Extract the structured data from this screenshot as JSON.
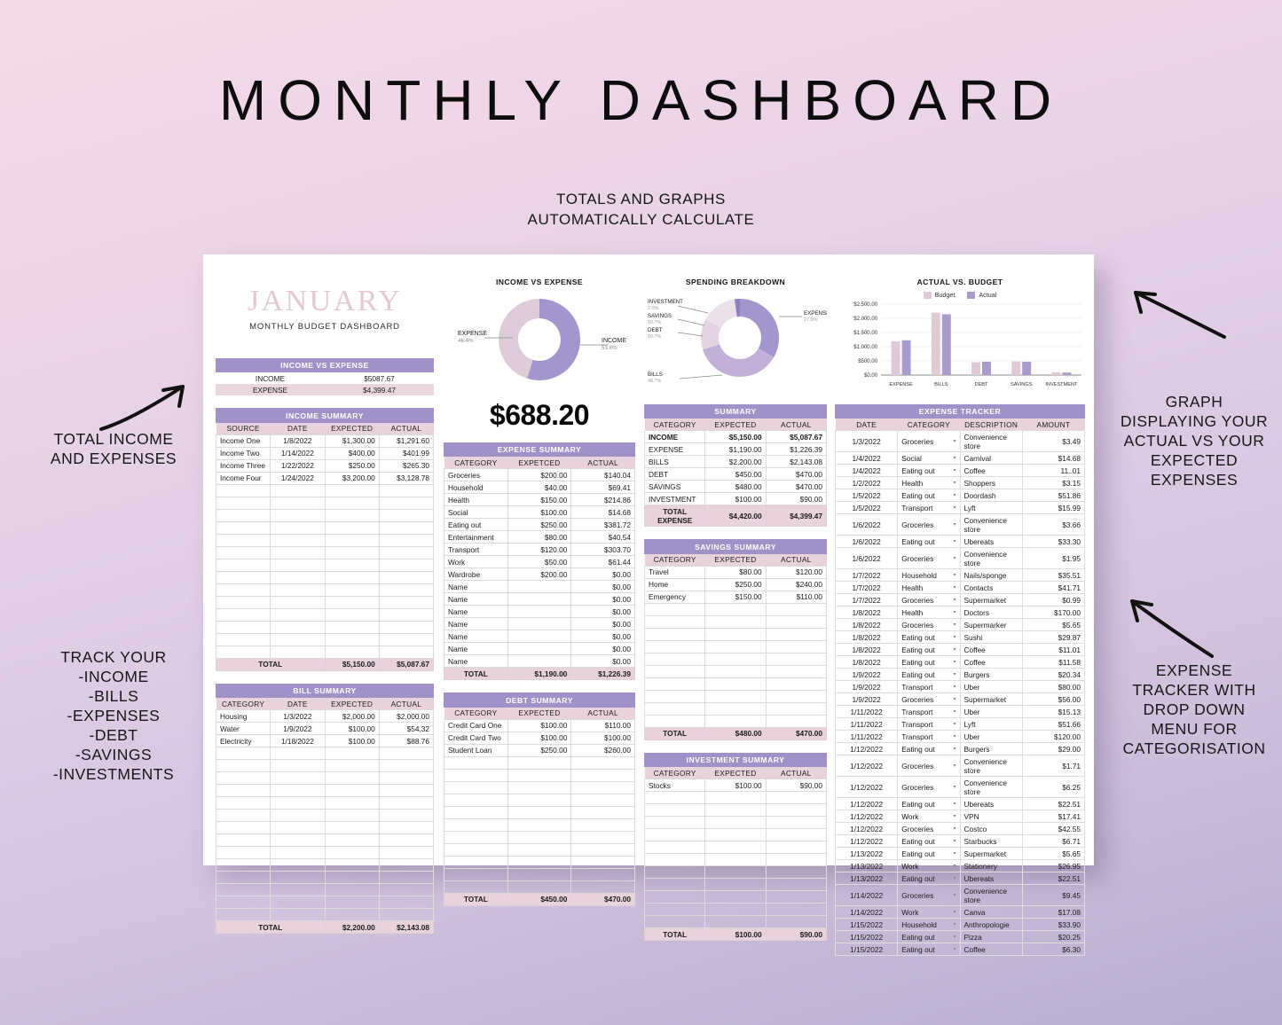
{
  "page": {
    "headline": "MONTHLY DASHBOARD",
    "subhead_line1": "TOTALS AND GRAPHS",
    "subhead_line2": "AUTOMATICALLY CALCULATE"
  },
  "annotations": {
    "top_left": "TOTAL INCOME\nAND EXPENSES",
    "bottom_left": "TRACK YOUR\n-INCOME\n-BILLS\n-EXPENSES\n-DEBT\n-SAVINGS\n-INVESTMENTS",
    "top_right": "GRAPH\nDISPLAYING YOUR\nACTUAL VS YOUR\nEXPECTED\nEXPENSES",
    "bottom_right": "EXPENSE\nTRACKER WITH\nDROP DOWN\nMENU FOR\nCATEGORISATION"
  },
  "colors": {
    "purple_header": "#a092c8",
    "pink_header": "#e8d3dd",
    "donut_income": "#a396cc",
    "donut_expense": "#decbd9",
    "bar_budget": "#e0c9d6",
    "bar_actual": "#a89ccd"
  },
  "sheet": {
    "month_title": "JANUARY",
    "month_subtitle": "MONTHLY BUDGET DASHBOARD",
    "income_vs_expense": {
      "title": "INCOME VS EXPENSE",
      "income_label": "INCOME",
      "income_value": "$5087.67",
      "expense_label": "EXPENSE",
      "expense_value": "$4,399.47"
    },
    "income_summary": {
      "title": "INCOME SUMMARY",
      "headers": [
        "SOURCE",
        "DATE",
        "EXPECTED",
        "ACTUAL"
      ],
      "rows": [
        [
          "Income One",
          "1/8/2022",
          "$1,300.00",
          "$1,291.60"
        ],
        [
          "Income Two",
          "1/14/2022",
          "$400.00",
          "$401.99"
        ],
        [
          "Income Three",
          "1/22/2022",
          "$250.00",
          "$265.30"
        ],
        [
          "Income Four",
          "1/24/2022",
          "$3,200.00",
          "$3,128.78"
        ]
      ],
      "blank_rows": 14,
      "total_label": "TOTAL",
      "total_expected": "$5,150.00",
      "total_actual": "$5,087.67"
    },
    "bill_summary": {
      "title": "BILL SUMMARY",
      "headers": [
        "CATEGORY",
        "DATE",
        "EXPECTED",
        "ACTUAL"
      ],
      "rows": [
        [
          "Housing",
          "1/3/2022",
          "$2,000.00",
          "$2,000.00"
        ],
        [
          "Water",
          "1/9/2022",
          "$100.00",
          "$54.32"
        ],
        [
          "Electricity",
          "1/18/2022",
          "$100.00",
          "$88.76"
        ]
      ],
      "blank_rows": 14,
      "total_label": "TOTAL",
      "total_expected": "$2,200.00",
      "total_actual": "$2,143.08"
    },
    "expense_summary": {
      "title": "EXPENSE SUMMARY",
      "headers": [
        "CATEGORY",
        "EXPETCED",
        "ACTUAL"
      ],
      "rows": [
        [
          "Groceries",
          "$200.00",
          "$140.04"
        ],
        [
          "Household",
          "$40.00",
          "$69.41"
        ],
        [
          "Health",
          "$150.00",
          "$214.86"
        ],
        [
          "Social",
          "$100.00",
          "$14.68"
        ],
        [
          "Eating out",
          "$250.00",
          "$381.72"
        ],
        [
          "Entertainment",
          "$80.00",
          "$40.54"
        ],
        [
          "Transport",
          "$120.00",
          "$303.70"
        ],
        [
          "Work",
          "$50.00",
          "$61.44"
        ],
        [
          "Wardrobe",
          "$200.00",
          "$0.00"
        ],
        [
          "Name",
          "",
          "$0.00"
        ],
        [
          "Name",
          "",
          "$0.00"
        ],
        [
          "Name",
          "",
          "$0.00"
        ],
        [
          "Name",
          "",
          "$0.00"
        ],
        [
          "Name",
          "",
          "$0.00"
        ],
        [
          "Name",
          "",
          "$0.00"
        ],
        [
          "Name",
          "",
          "$0.00"
        ]
      ],
      "total_label": "TOTAL",
      "total_expected": "$1,190.00",
      "total_actual": "$1,226.39"
    },
    "debt_summary": {
      "title": "DEBT SUMMARY",
      "headers": [
        "CATEGORY",
        "EXPECTED",
        "ACTUAL"
      ],
      "rows": [
        [
          "Credit Card One",
          "$100.00",
          "$110.00"
        ],
        [
          "Credit Card Two",
          "$100.00",
          "$100.00"
        ],
        [
          "Student Loan",
          "$250.00",
          "$260.00"
        ]
      ],
      "blank_rows": 11,
      "total_label": "TOTAL",
      "total_expected": "$450.00",
      "total_actual": "$470.00"
    },
    "summary": {
      "title": "SUMMARY",
      "headers": [
        "CATEGORY",
        "EXPECTED",
        "ACTUAL"
      ],
      "rows": [
        [
          "INCOME",
          "$5,150.00",
          "$5,087.67"
        ],
        [
          "EXPENSE",
          "$1,190.00",
          "$1,226.39"
        ],
        [
          "BILLS",
          "$2,200.00",
          "$2,143.08"
        ],
        [
          "DEBT",
          "$450.00",
          "$470.00"
        ],
        [
          "SAVINGS",
          "$480.00",
          "$470.00"
        ],
        [
          "INVESTMENT",
          "$100.00",
          "$90.00"
        ]
      ],
      "total_label": "TOTAL EXPENSE",
      "total_expected": "$4,420.00",
      "total_actual": "$4,399.47"
    },
    "savings_summary": {
      "title": "SAVINGS SUMMARY",
      "headers": [
        "CATEGORY",
        "EXPECTED",
        "ACTUAL"
      ],
      "rows": [
        [
          "Travel",
          "$80.00",
          "$120.00"
        ],
        [
          "Home",
          "$250.00",
          "$240.00"
        ],
        [
          "Emergency",
          "$150.00",
          "$110.00"
        ]
      ],
      "blank_rows": 10,
      "total_label": "TOTAL",
      "total_expected": "$480.00",
      "total_actual": "$470.00"
    },
    "investment_summary": {
      "title": "INVESTMENT SUMMARY",
      "headers": [
        "CATEGORY",
        "EXPECTED",
        "ACTUAL"
      ],
      "rows": [
        [
          "Stocks",
          "$100.00",
          "$90.00"
        ]
      ],
      "blank_rows": 11,
      "total_label": "TOTAL",
      "total_expected": "$100.00",
      "total_actual": "$90.00"
    },
    "expense_tracker": {
      "title": "EXPENSE TRACKER",
      "headers": [
        "DATE",
        "CATEGORY",
        "DESCRIPTION",
        "AMOUNT"
      ],
      "rows": [
        [
          "1/3/2022",
          "Groceries",
          "Convenience store",
          "$3.49"
        ],
        [
          "1/4/2022",
          "Social",
          "Carnival",
          "$14.68"
        ],
        [
          "1/4/2022",
          "Eating out",
          "Coffee",
          "11..01"
        ],
        [
          "1/2/2022",
          "Health",
          "Shoppers",
          "$3.15"
        ],
        [
          "1/5/2022",
          "Eating out",
          "Doordash",
          "$51.86"
        ],
        [
          "1/5/2022",
          "Transport",
          "Lyft",
          "$15.99"
        ],
        [
          "1/6/2022",
          "Groceries",
          "Convenience store",
          "$3.66"
        ],
        [
          "1/6/2022",
          "Eating out",
          "Ubereats",
          "$33.30"
        ],
        [
          "1/6/2022",
          "Groceries",
          "Convenience store",
          "$1.95"
        ],
        [
          "1/7/2022",
          "Household",
          "Nails/sponge",
          "$35.51"
        ],
        [
          "1/7/2022",
          "Health",
          "Contacts",
          "$41.71"
        ],
        [
          "1/7/2022",
          "Groceries",
          "Supermarket",
          "$0.99"
        ],
        [
          "1/8/2022",
          "Health",
          "Doctors",
          "$170.00"
        ],
        [
          "1/8/2022",
          "Groceries",
          "Supermarker",
          "$5.65"
        ],
        [
          "1/8/2022",
          "Eating out",
          "Sushi",
          "$29.87"
        ],
        [
          "1/8/2022",
          "Eating out",
          "Coffee",
          "$11.01"
        ],
        [
          "1/8/2022",
          "Eating out",
          "Coffee",
          "$11.58"
        ],
        [
          "1/9/2022",
          "Eating out",
          "Burgers",
          "$20.34"
        ],
        [
          "1/9/2022",
          "Transport",
          "Uber",
          "$80.00"
        ],
        [
          "1/9/2022",
          "Groceries",
          "Supermarket",
          "$56.00"
        ],
        [
          "1/11/2022",
          "Transport",
          "Uber",
          "$15.13"
        ],
        [
          "1/11/2022",
          "Transport",
          "Lyft",
          "$51.66"
        ],
        [
          "1/11/2022",
          "Transport",
          "Uber",
          "$120.00"
        ],
        [
          "1/12/2022",
          "Eating out",
          "Burgers",
          "$29.00"
        ],
        [
          "1/12/2022",
          "Groceries",
          "Convenience store",
          "$1.71"
        ],
        [
          "1/12/2022",
          "Groceries",
          "Convenience store",
          "$6.25"
        ],
        [
          "1/12/2022",
          "Eating out",
          "Ubereats",
          "$22.51"
        ],
        [
          "1/12/2022",
          "Work",
          "VPN",
          "$17.41"
        ],
        [
          "1/12/2022",
          "Groceries",
          "Costco",
          "$42.55"
        ],
        [
          "1/12/2022",
          "Eating out",
          "Starbucks",
          "$6.71"
        ],
        [
          "1/13/2022",
          "Eating out",
          "Supermarket",
          "$5.65"
        ],
        [
          "1/13/2022",
          "Work",
          "Stationery",
          "$26.95"
        ],
        [
          "1/13/2022",
          "Eating out",
          "Ubereats",
          "$22.51"
        ],
        [
          "1/14/2022",
          "Groceries",
          "Convenience store",
          "$9.45"
        ],
        [
          "1/14/2022",
          "Work",
          "Canva",
          "$17.08"
        ],
        [
          "1/15/2022",
          "Household",
          "Anthropologie",
          "$33.90"
        ],
        [
          "1/15/2022",
          "Eating out",
          "Pizza",
          "$20.25"
        ],
        [
          "1/15/2022",
          "Eating out",
          "Coffee",
          "$6.30"
        ]
      ]
    }
  },
  "chart_data": [
    {
      "type": "pie",
      "id": "income-vs-expense-donut",
      "title": "INCOME VS EXPENSE",
      "labels": [
        "INCOME",
        "EXPENSE"
      ],
      "values": [
        53.6,
        46.4
      ],
      "value_labels": [
        "53.6%",
        "46.4%"
      ],
      "colors": [
        "#a396cc",
        "#decbd9"
      ],
      "center_value": "$688.20",
      "legend": "callout-labels"
    },
    {
      "type": "pie",
      "id": "spending-breakdown-donut",
      "title": "SPENDING BREAKDOWN",
      "labels": [
        "EXPENSE",
        "BILLS",
        "DEBT",
        "SAVINGS",
        "INVESTMENT"
      ],
      "values": [
        27.9,
        48.7,
        10.7,
        10.7,
        2.0
      ],
      "value_labels": [
        "27.9%",
        "48.7%",
        "10.7%",
        "10.7%",
        "2.0%"
      ],
      "colors": [
        "#a396cc",
        "#c3b0d8",
        "#e3d3e3",
        "#ece0ea",
        "#8e7fc0"
      ],
      "legend": "callout-labels"
    },
    {
      "type": "bar",
      "id": "actual-vs-budget-bars",
      "title": "ACTUAL VS. BUDGET",
      "categories": [
        "EXPENSE",
        "BILLS",
        "DEBT",
        "SAVINGS",
        "INVESTMENT"
      ],
      "series": [
        {
          "name": "Budget",
          "values": [
            1190,
            2200,
            450,
            480,
            100
          ],
          "color": "#e0c9d6"
        },
        {
          "name": "Actual",
          "values": [
            1226.39,
            2143.08,
            470,
            470,
            90
          ],
          "color": "#a89ccd"
        }
      ],
      "ylim": [
        0,
        2500
      ],
      "yticks": [
        "$0.00",
        "$500.00",
        "$1,000.00",
        "$1,500.00",
        "$2,000.00",
        "$2,500.00"
      ],
      "ylabel": "",
      "xlabel": "",
      "grid": true,
      "legend_position": "top"
    }
  ]
}
